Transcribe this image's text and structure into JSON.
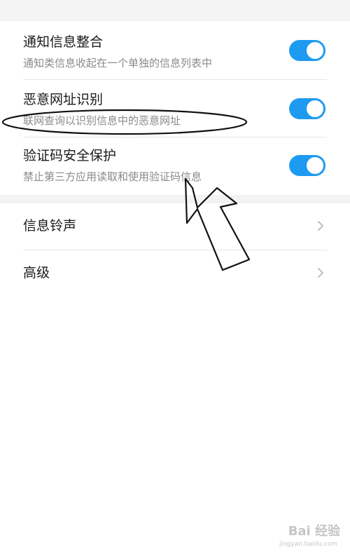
{
  "settings": {
    "items": [
      {
        "title": "通知信息整合",
        "subtitle": "通知类信息收起在一个单独的信息列表中",
        "enabled": true
      },
      {
        "title": "恶意网址识别",
        "subtitle": "联网查询以识别信息中的恶意网址",
        "enabled": true
      },
      {
        "title": "验证码安全保护",
        "subtitle": "禁止第三方应用读取和使用验证码信息",
        "enabled": true
      }
    ],
    "links": [
      {
        "title": "信息铃声",
        "icon": "chevron-right-icon"
      },
      {
        "title": "高级",
        "icon": "chevron-right-icon"
      }
    ]
  },
  "colors": {
    "toggle_on": "#1e9bf0",
    "background_gap": "#f3f3f3",
    "subtitle_text": "#8a8a8a"
  },
  "watermark": {
    "text": "Bai 经验",
    "url_text": "jingyan.baidu.com"
  }
}
